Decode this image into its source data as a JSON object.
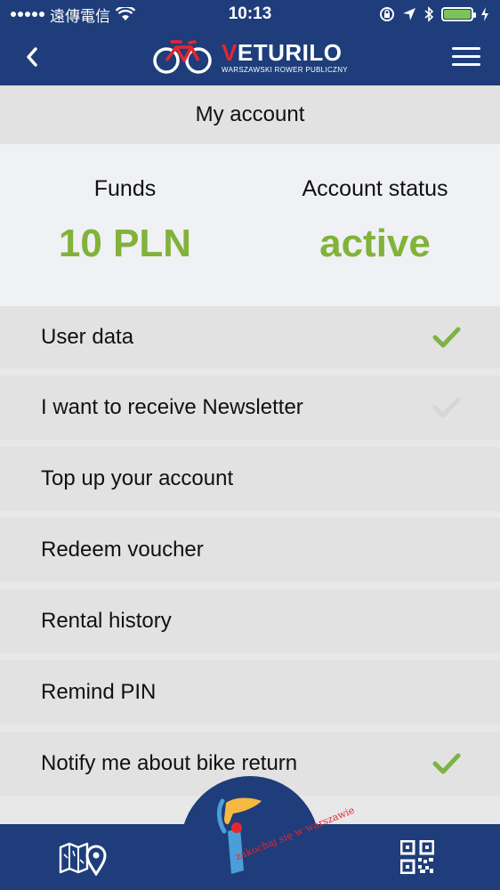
{
  "status_bar": {
    "carrier": "遠傳電信",
    "time": "10:13",
    "battery_level": 1.0
  },
  "header": {
    "logo_title_first": "V",
    "logo_title_rest": "ETURILO",
    "logo_subtitle": "WARSZAWSKI ROWER PUBLICZNY"
  },
  "page": {
    "title": "My account"
  },
  "account": {
    "funds_label": "Funds",
    "funds_value": "10 PLN",
    "status_label": "Account status",
    "status_value": "active"
  },
  "menu": {
    "items": [
      {
        "label": "User data",
        "check": "checked"
      },
      {
        "label": "I want to receive Newsletter",
        "check": "unchecked"
      },
      {
        "label": "Top up your account",
        "check": "none"
      },
      {
        "label": "Redeem voucher",
        "check": "none"
      },
      {
        "label": "Rental history",
        "check": "none"
      },
      {
        "label": "Remind PIN",
        "check": "none"
      },
      {
        "label": "Notify me about bike return",
        "check": "checked"
      }
    ]
  },
  "bottom_bar": {
    "badge_text": "zakochaj się w warszawie"
  },
  "colors": {
    "brand_navy": "#1e3d7a",
    "accent_green": "#82b23a",
    "check_green": "#7cb342",
    "check_grey": "#d6d6d6",
    "logo_red": "#e52631"
  }
}
